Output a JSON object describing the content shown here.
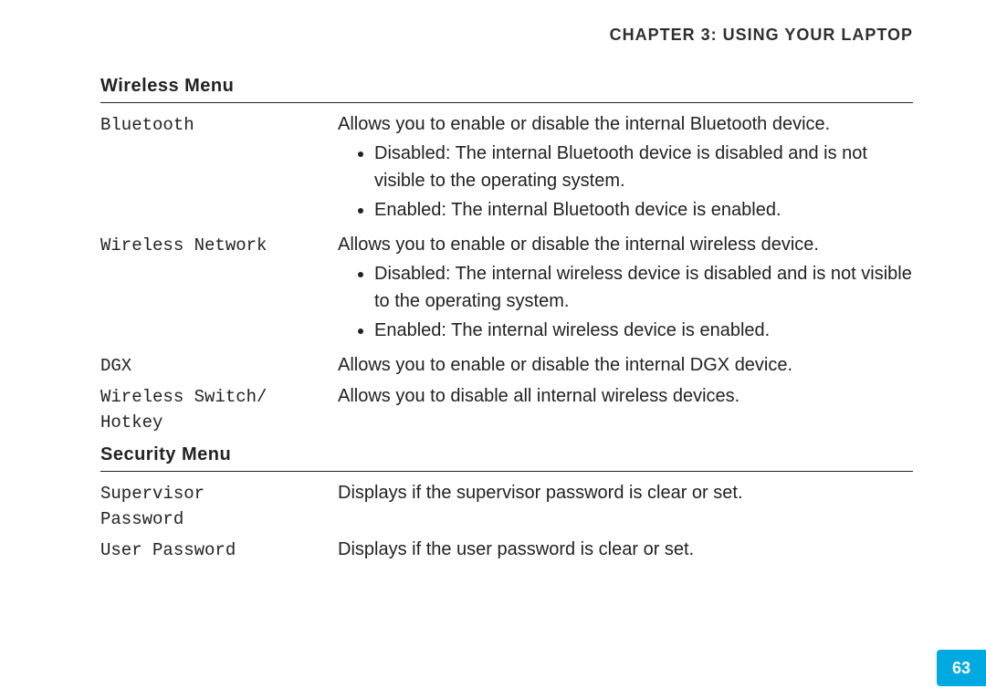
{
  "chapter_header": "CHAPTER 3: USING YOUR LAPTOP",
  "page_number": "63",
  "sections": [
    {
      "title": "Wireless Menu",
      "rows": [
        {
          "label": "Bluetooth",
          "text": "Allows you to enable or disable the internal Bluetooth device.",
          "bullets": [
            "Disabled: The internal Bluetooth device is disabled and is not visible to the operating system.",
            "Enabled: The internal Bluetooth device is enabled."
          ]
        },
        {
          "label": "Wireless Network",
          "text": "Allows you to enable or disable the internal wireless device.",
          "bullets": [
            "Disabled: The internal wireless device is disabled and is not visible to the operating system.",
            "Enabled: The internal wireless device is enabled."
          ]
        },
        {
          "label": "DGX",
          "text": "Allows you to enable or disable the internal DGX device.",
          "bullets": []
        },
        {
          "label": "Wireless Switch/\nHotkey",
          "text": "Allows you to disable all internal wireless devices.",
          "bullets": []
        }
      ]
    },
    {
      "title": "Security Menu",
      "rows": [
        {
          "label": "Supervisor\nPassword",
          "text": "Displays if the supervisor password is clear or set.",
          "bullets": []
        },
        {
          "label": "User Password",
          "text": "Displays if the user password is clear or set.",
          "bullets": []
        }
      ]
    }
  ]
}
